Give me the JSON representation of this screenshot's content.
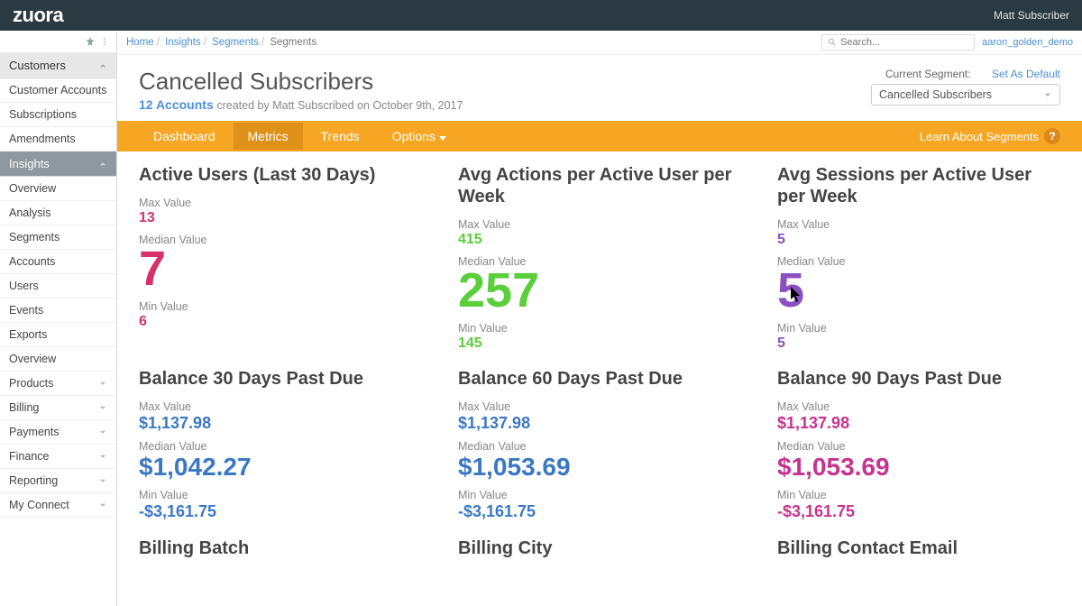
{
  "brand": "zuora",
  "user": "Matt Subscriber",
  "tenant": "aaron_golden_demo",
  "search_placeholder": "Search...",
  "breadcrumbs": {
    "home": "Home",
    "insights": "Insights",
    "segments": "Segments",
    "current": "Segments"
  },
  "sidebar": {
    "customers": {
      "title": "Customers",
      "items": [
        "Customer Accounts",
        "Subscriptions",
        "Amendments"
      ]
    },
    "insights": {
      "title": "Insights",
      "items": [
        "Overview",
        "Analysis",
        "Segments",
        "Accounts",
        "Users",
        "Events",
        "Exports",
        "Overview"
      ]
    },
    "bottom": [
      "Products",
      "Billing",
      "Payments",
      "Finance",
      "Reporting",
      "My Connect"
    ]
  },
  "header": {
    "title": "Cancelled Subscribers",
    "count": "12 Accounts",
    "created": "created by Matt Subscribed on October 9th, 2017",
    "segment_label": "Current Segment:",
    "segment_value": "Cancelled Subscribers",
    "set_default": "Set As Default"
  },
  "tabs": {
    "dashboard": "Dashboard",
    "metrics": "Metrics",
    "trends": "Trends",
    "options": "Options",
    "learn": "Learn About Segments",
    "q": "?"
  },
  "metrics": {
    "m1": {
      "title": "Active Users (Last 30 Days)",
      "max_l": "Max Value",
      "max": "13",
      "med_l": "Median Value",
      "med": "7",
      "min_l": "Min Value",
      "min": "6"
    },
    "m2": {
      "title": "Avg Actions per Active User per Week",
      "max_l": "Max Value",
      "max": "415",
      "med_l": "Median Value",
      "med": "257",
      "min_l": "Min Value",
      "min": "145"
    },
    "m3": {
      "title": "Avg Sessions per Active User per Week",
      "max_l": "Max Value",
      "max": "5",
      "med_l": "Median Value",
      "med": "5",
      "min_l": "Min Value",
      "min": "5"
    },
    "m4": {
      "title": "Balance 30 Days Past Due",
      "max_l": "Max Value",
      "max": "$1,137.98",
      "med_l": "Median Value",
      "med": "$1,042.27",
      "min_l": "Min Value",
      "min": "-$3,161.75"
    },
    "m5": {
      "title": "Balance 60 Days Past Due",
      "max_l": "Max Value",
      "max": "$1,137.98",
      "med_l": "Median Value",
      "med": "$1,053.69",
      "min_l": "Min Value",
      "min": "-$3,161.75"
    },
    "m6": {
      "title": "Balance 90 Days Past Due",
      "max_l": "Max Value",
      "max": "$1,137.98",
      "med_l": "Median Value",
      "med": "$1,053.69",
      "min_l": "Min Value",
      "min": "-$3,161.75"
    },
    "m7": {
      "title": "Billing Batch"
    },
    "m8": {
      "title": "Billing City"
    },
    "m9": {
      "title": "Billing Contact Email"
    }
  }
}
